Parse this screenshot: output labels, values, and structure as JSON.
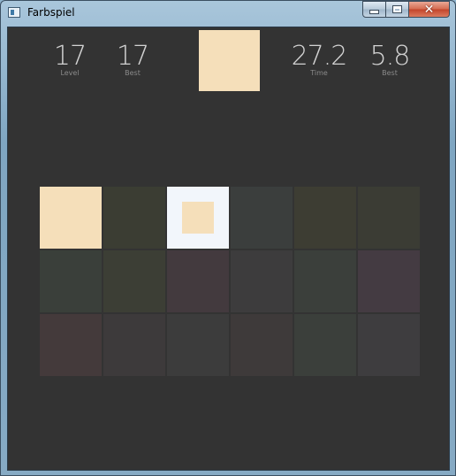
{
  "window": {
    "title": "Farbspiel"
  },
  "controls": {
    "minimize_icon": "minimize-icon",
    "maximize_icon": "maximize-icon",
    "close_glyph": "✕"
  },
  "stats": [
    {
      "value": "17",
      "label": "Level"
    },
    {
      "value": "17",
      "label": "Best"
    },
    {
      "value": "27.2",
      "label": "Time"
    },
    {
      "value": "5.8",
      "label": "Best"
    }
  ],
  "target_color": "#f5dfba",
  "grid": {
    "columns": 6,
    "selected_index": 2,
    "selected_inner_color": "#f5dfba",
    "cells": [
      "#f5dfba",
      "#3b3d33",
      "#f2f6fb",
      "#3b3e3d",
      "#3d3d33",
      "#3b3c34",
      "#3a3f3a",
      "#3c3e35",
      "#433a3e",
      "#3d3c3d",
      "#3b3f3b",
      "#443b42",
      "#443a3b",
      "#3d3a3b",
      "#3c3c3c",
      "#3e3a3a",
      "#3b3f3b",
      "#3e3d3f"
    ]
  }
}
